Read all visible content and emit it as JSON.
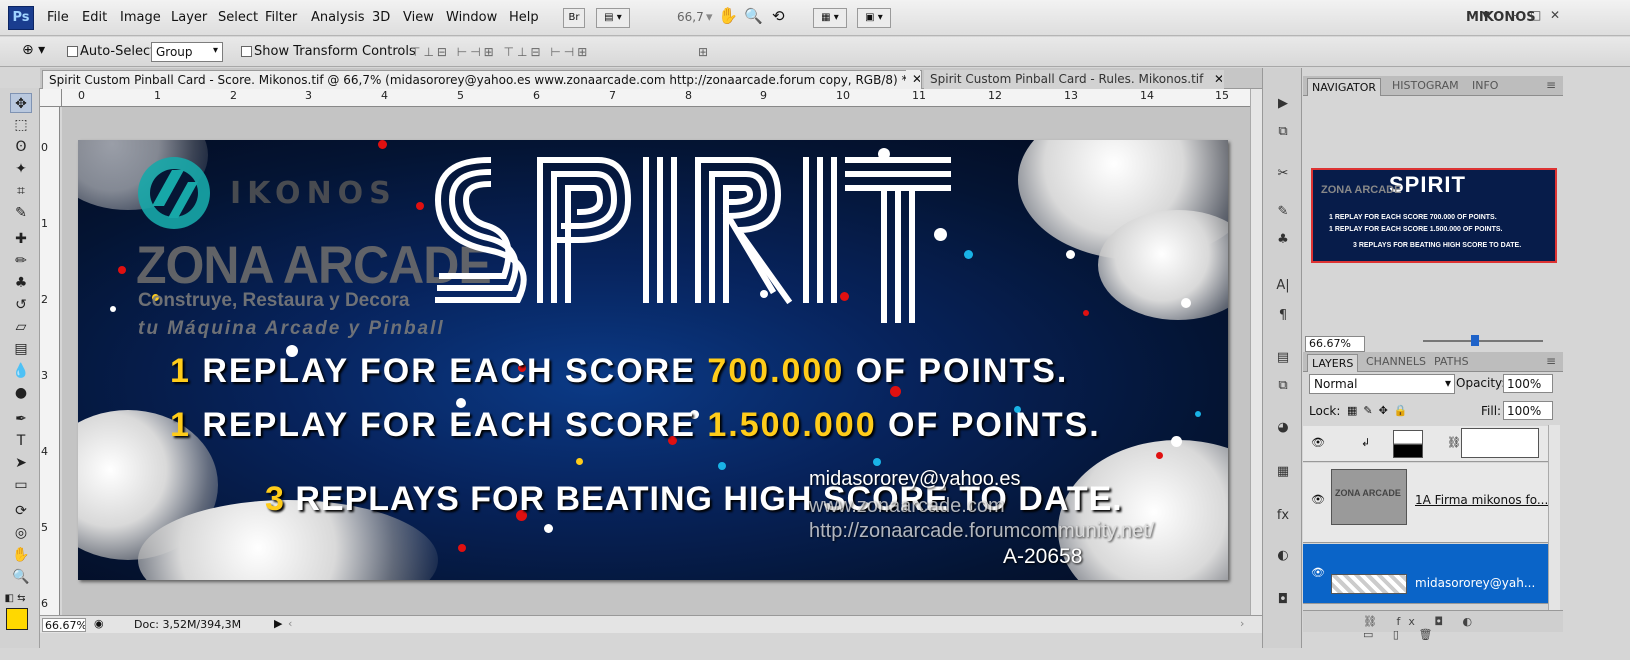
{
  "app": {
    "logo": "Ps",
    "workspace": "MIKONOS",
    "zoom": "66,7"
  },
  "menu": [
    "File",
    "Edit",
    "Image",
    "Layer",
    "Select",
    "Filter",
    "Analysis",
    "3D",
    "View",
    "Window",
    "Help"
  ],
  "menubar_buttons": {
    "bridge": "Br",
    "window_min": "–",
    "window_max": "□",
    "window_close": "✕"
  },
  "options": {
    "auto_select_label": "Auto-Select:",
    "auto_select_value": "Group",
    "show_transform_label": "Show Transform Controls"
  },
  "tabs": [
    {
      "label": "Spirit Custom Pinball Card - Score. Mikonos.tif @ 66,7% (midasororey@yahoo.es www.zonaarcade.com http://zonaarcade.forum copy, RGB/8) *",
      "close": "✕"
    },
    {
      "label": "Spirit Custom Pinball Card - Rules. Mikonos.tif",
      "close": "✕"
    }
  ],
  "ruler": {
    "horizontal": [
      "0",
      "1",
      "2",
      "3",
      "4",
      "5",
      "6",
      "7",
      "8",
      "9",
      "10",
      "11",
      "12",
      "13",
      "14",
      "15"
    ],
    "vertical": [
      "0",
      "1",
      "2",
      "3",
      "4",
      "5",
      "6"
    ]
  },
  "status": {
    "zoom": "66.67%",
    "doc": "Doc: 3,52M/394,3M"
  },
  "artwork": {
    "brand": "IKONOS",
    "zona": "ZONA ARCADE",
    "tagline1": "Construye, Restaura y Decora",
    "tagline2": "tu Máquina Arcade y Pinball",
    "title": "SPIRIT",
    "line1": {
      "n": "1",
      "a": " REPLAY FOR EACH SCORE ",
      "v": "700.000",
      "b": " OF POINTS."
    },
    "line2": {
      "n": "1",
      "a": " REPLAY FOR EACH SCORE ",
      "v": "1.500.000",
      "b": " OF POINTS."
    },
    "line3": {
      "n": "3",
      "a": " REPLAYS FOR BEATING HIGH SCORE TO DATE."
    },
    "email": "midasororey@yahoo.es",
    "www": "www.zonaarcade.com",
    "url": "http://zonaarcade.forumcommunity.net/",
    "code": "A-20658",
    "highlight_color": "#ffcc1a"
  },
  "navigator": {
    "tabs": [
      "NAVIGATOR",
      "HISTOGRAM",
      "INFO"
    ],
    "zoom": "66.67%",
    "thumb_line1": "1 REPLAY FOR EACH SCORE 700.000 OF POINTS.",
    "thumb_line2": "1 REPLAY FOR EACH SCORE 1.500.000 OF POINTS.",
    "thumb_line3": "3 REPLAYS FOR BEATING HIGH SCORE TO DATE."
  },
  "layers": {
    "tabs": [
      "LAYERS",
      "CHANNELS",
      "PATHS"
    ],
    "blend_mode": "Normal",
    "opacity_label": "Opacity:",
    "opacity": "100%",
    "lock_label": "Lock:",
    "fill_label": "Fill:",
    "fill": "100%",
    "items": [
      {
        "name": ""
      },
      {
        "name": "1A Firma mikonos fo..."
      },
      {
        "name": "midasororey@yah..."
      }
    ],
    "footer_icons": "⛓ fx ◘ ◐ ▭ ▯ 🗑"
  },
  "colors": {
    "foreground": "#ffd800",
    "selection": "#0a64c8"
  }
}
